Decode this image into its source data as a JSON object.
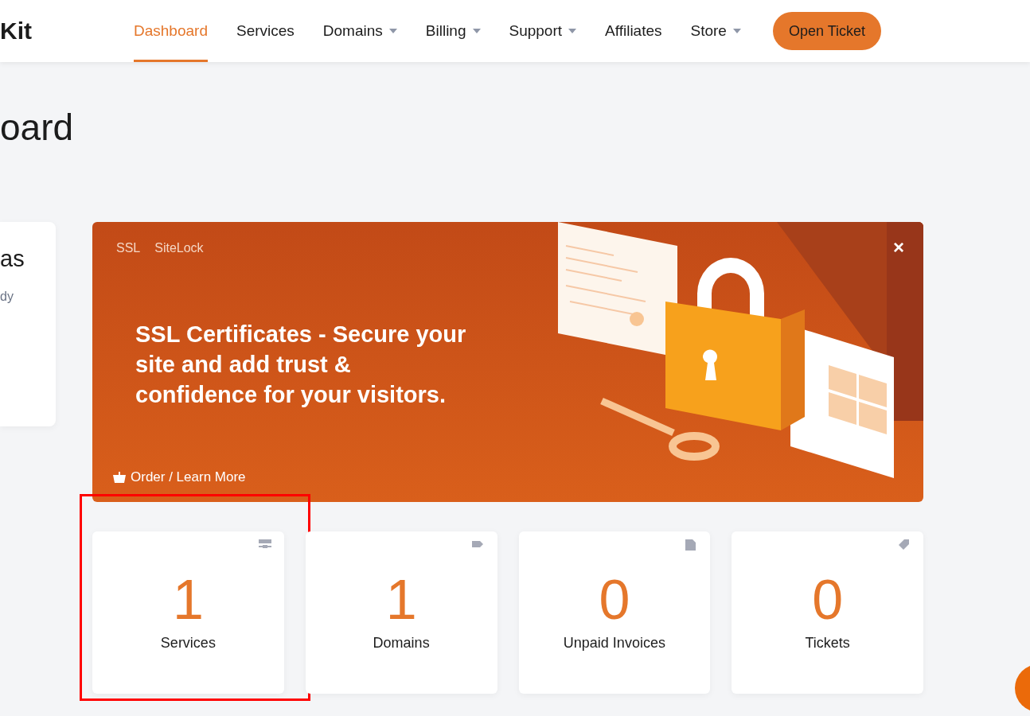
{
  "header": {
    "logo": "Kit",
    "nav": [
      {
        "label": "Dashboard",
        "selected": true,
        "dropdown": false
      },
      {
        "label": "Services",
        "selected": false,
        "dropdown": false
      },
      {
        "label": "Domains",
        "selected": false,
        "dropdown": true
      },
      {
        "label": "Billing",
        "selected": false,
        "dropdown": true
      },
      {
        "label": "Support",
        "selected": false,
        "dropdown": true
      },
      {
        "label": "Affiliates",
        "selected": false,
        "dropdown": false
      },
      {
        "label": "Store",
        "selected": false,
        "dropdown": true
      }
    ],
    "cta": "Open Ticket"
  },
  "page_title": "oard",
  "side_card": {
    "title": "as",
    "text": "dy"
  },
  "banner": {
    "tabs": [
      "SSL",
      "SiteLock"
    ],
    "headline": "SSL Certificates - Secure your site and add trust & confidence for your visitors.",
    "link": "Order / Learn More",
    "close": "×"
  },
  "stats": [
    {
      "value": "1",
      "label": "Services",
      "kind": "server",
      "highlighted": true
    },
    {
      "value": "1",
      "label": "Domains",
      "kind": "label",
      "highlighted": false
    },
    {
      "value": "0",
      "label": "Unpaid Invoices",
      "kind": "document",
      "highlighted": false
    },
    {
      "value": "0",
      "label": "Tickets",
      "kind": "tag",
      "highlighted": false
    }
  ]
}
